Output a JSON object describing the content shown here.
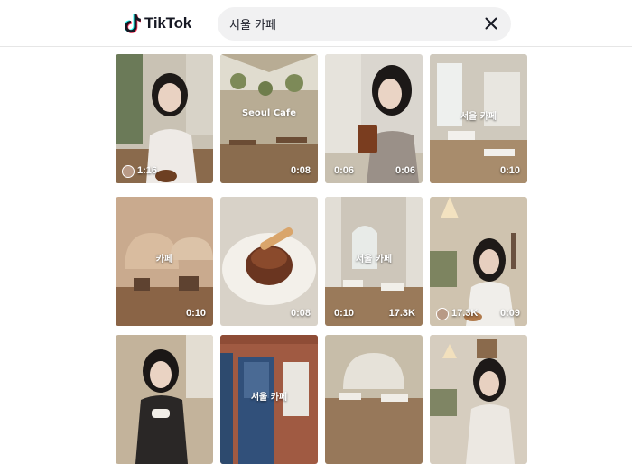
{
  "app": {
    "brand": "TikTok"
  },
  "search": {
    "query": "서울 카페"
  },
  "icons": {
    "clear": "close-icon",
    "logo": "tiktok-logo-icon"
  },
  "tiles": [
    {
      "caption": "",
      "left_stat": "1:16",
      "right_stat": "",
      "has_avatar": true
    },
    {
      "caption": "Seoul Cafe",
      "left_stat": "",
      "right_stat": "0:08",
      "has_avatar": false
    },
    {
      "caption": "",
      "left_stat": "0:06",
      "right_stat": "0:06",
      "has_avatar": false
    },
    {
      "caption": "서울 카페",
      "left_stat": "",
      "right_stat": "0:10",
      "has_avatar": false
    },
    {
      "caption": "카페",
      "left_stat": "",
      "right_stat": "0:10",
      "has_avatar": false
    },
    {
      "caption": "",
      "left_stat": "",
      "right_stat": "0:08",
      "has_avatar": false
    },
    {
      "caption": "서울 카페",
      "left_stat": "0:10",
      "right_stat": "17.3K",
      "has_avatar": false
    },
    {
      "caption": "",
      "left_stat": "17.3K",
      "right_stat": "0:09",
      "has_avatar": true
    },
    {
      "caption": "",
      "left_stat": "",
      "right_stat": "",
      "has_avatar": false
    },
    {
      "caption": "서울 카페",
      "left_stat": "",
      "right_stat": "",
      "has_avatar": false
    },
    {
      "caption": "",
      "left_stat": "",
      "right_stat": "",
      "has_avatar": false
    },
    {
      "caption": "",
      "left_stat": "",
      "right_stat": "",
      "has_avatar": false
    }
  ]
}
